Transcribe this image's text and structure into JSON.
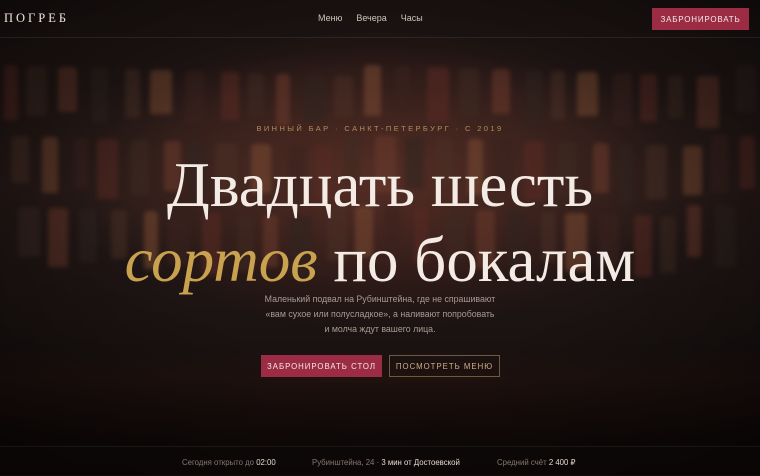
{
  "nav": {
    "logo": "ПОГРЕБ",
    "links": [
      "Меню",
      "Вечера",
      "Часы"
    ],
    "cta": "ЗАБРОНИРОВАТЬ"
  },
  "hero": {
    "eyebrow": "ВИННЫЙ БАР · САНКТ-ПЕТЕРБУРГ · С 2019",
    "headline_line1": "Двадцать шесть",
    "headline_accent": "сортов",
    "headline_line2_rest": " по бокалам",
    "subtitle": "Маленький подвал на Рубинштейна, где не спрашивают «вам сухое или полусладкое», а наливают попробовать и молча ждут вашего лица.",
    "primary_button": "ЗАБРОНИРОВАТЬ СТОЛ",
    "secondary_button": "ПОСМОТРЕТЬ МЕНЮ"
  },
  "info": {
    "hours_label": "Сегодня открыто до",
    "hours_value": "02:00",
    "address_label": "Рубинштейна, 24 ·",
    "address_value": "3 мин от Достоевской",
    "bill_label": "Средний счёт",
    "bill_value": "2 400 ₽"
  },
  "colors": {
    "accent_burgundy": "#9b2c43",
    "accent_gold": "#c9a24f",
    "background": "#1a1211"
  }
}
